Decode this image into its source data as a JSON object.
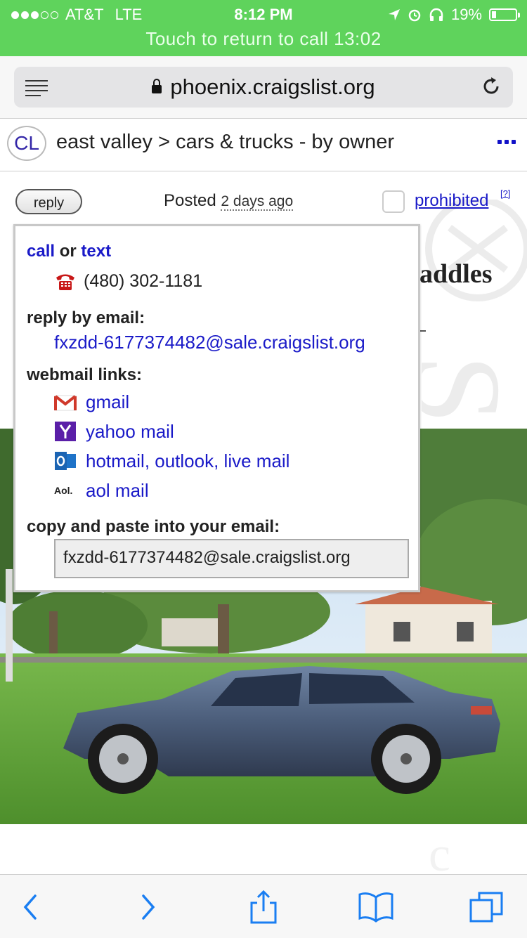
{
  "status_bar": {
    "carrier": "AT&T",
    "network": "LTE",
    "time": "8:12 PM",
    "battery": "19%",
    "battery_level": 0.19,
    "call_banner": "Touch to return to call 13:02"
  },
  "browser": {
    "url": "phoenix.craigslist.org"
  },
  "breadcrumb": {
    "logo": "CL",
    "path": "east valley > cars & trucks - by owner"
  },
  "posting": {
    "reply_label": "reply",
    "posted_label": "Posted",
    "posted_ago": "2 days ago",
    "prohibited_label": "prohibited",
    "help_label": "[?]",
    "title_fragment": "addles"
  },
  "reply_popup": {
    "call_label": "call",
    "or_label": "or",
    "text_label": "text",
    "phone": "(480) 302-1181",
    "reply_email_label": "reply by email:",
    "email": "fxzdd-6177374482@sale.craigslist.org",
    "webmail_label": "webmail links:",
    "webmail": [
      {
        "icon": "gmail-icon",
        "label": "gmail"
      },
      {
        "icon": "yahoo-icon",
        "label": "yahoo mail"
      },
      {
        "icon": "outlook-icon",
        "label": "hotmail, outlook, live mail"
      },
      {
        "icon": "aol-icon",
        "label": "aol mail",
        "icon_text": "Aol."
      }
    ],
    "copy_label": "copy and paste into your email:",
    "copy_value": "fxzdd-6177374482@sale.craigslist.org"
  },
  "colors": {
    "status_green": "#5fd35c",
    "link_blue": "#1a1ac8",
    "ios_blue": "#1a7ef2"
  }
}
